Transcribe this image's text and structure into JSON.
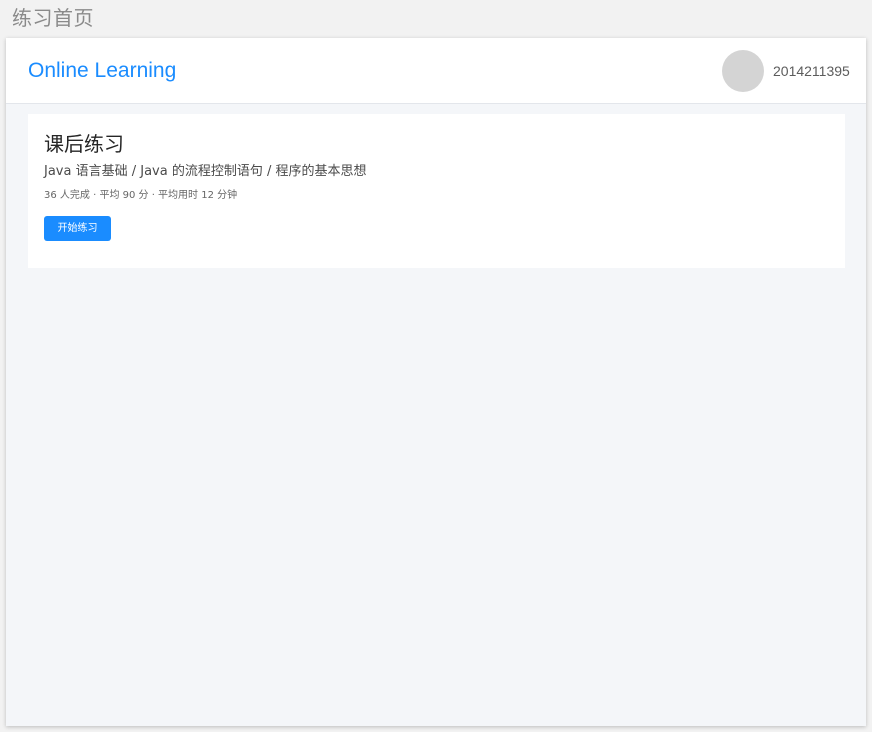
{
  "page_label": "练习首页",
  "header": {
    "brand": "Online Learning",
    "user_id": "2014211395"
  },
  "exercise_card": {
    "title": "课后练习",
    "breadcrumb": "Java 语言基础 / Java 的流程控制语句 / 程序的基本思想",
    "stats": "36 人完成 · 平均 90 分 · 平均用时 12 分钟",
    "start_button_label": "开始练习"
  },
  "colors": {
    "accent": "#1a8cff",
    "content_background": "#f4f6f9",
    "avatar_placeholder": "#d4d4d4"
  }
}
